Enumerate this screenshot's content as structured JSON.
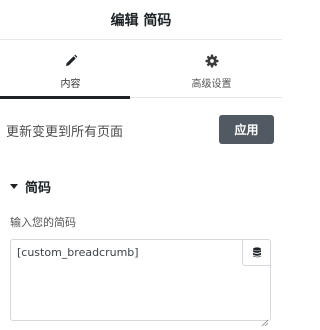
{
  "header": {
    "title": "编辑 简码"
  },
  "tabs": [
    {
      "label": "内容",
      "icon": "pencil-icon",
      "active": true
    },
    {
      "label": "高级设置",
      "icon": "gear-icon",
      "active": false
    }
  ],
  "apply_row": {
    "text": "更新变更到所有页面",
    "button_label": "应用"
  },
  "section": {
    "title": "简码",
    "expanded": true
  },
  "shortcode_field": {
    "label": "输入您的简码",
    "value": "[custom_breadcrumb]",
    "dynamic_icon": "database-icon"
  },
  "colors": {
    "button_bg": "#515962",
    "active_tab_bar": "#1d2327",
    "text": "#3c3c3c"
  }
}
